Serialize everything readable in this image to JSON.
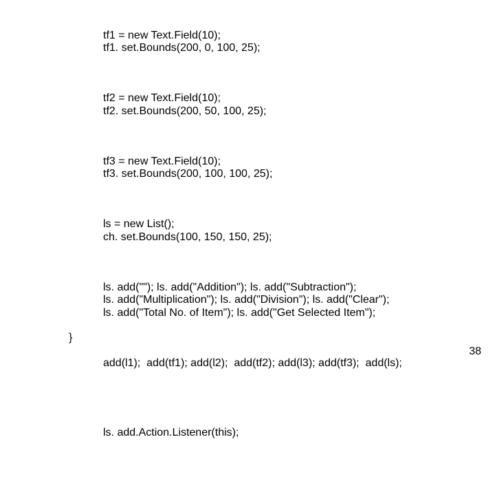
{
  "code": {
    "p1l1": "tf1 = new Text.Field(10);",
    "p1l2": "tf1. set.Bounds(200, 0, 100, 25);",
    "p2l1": "tf2 = new Text.Field(10);",
    "p2l2": "tf2. set.Bounds(200, 50, 100, 25);",
    "p3l1": "tf3 = new Text.Field(10);",
    "p3l2": "tf3. set.Bounds(200, 100, 100, 25);",
    "p4l1": "ls = new List();",
    "p4l2": "ch. set.Bounds(100, 150, 150, 25);",
    "p5l1": "ls. add(\"\"); ls. add(\"Addition\"); ls. add(\"Subtraction\");",
    "p5l2": "ls. add(\"Multiplication\"); ls. add(\"Division\"); ls. add(\"Clear\");",
    "p5l3": "ls. add(\"Total No. of Item\"); ls. add(\"Get Selected Item\");",
    "p6l1": "add(l1);  add(tf1); add(l2);  add(tf2); add(l3); add(tf3);  add(ls);",
    "p7l1": "ls. add.Action.Listener(this);",
    "closing": "}"
  },
  "page_number": "38"
}
